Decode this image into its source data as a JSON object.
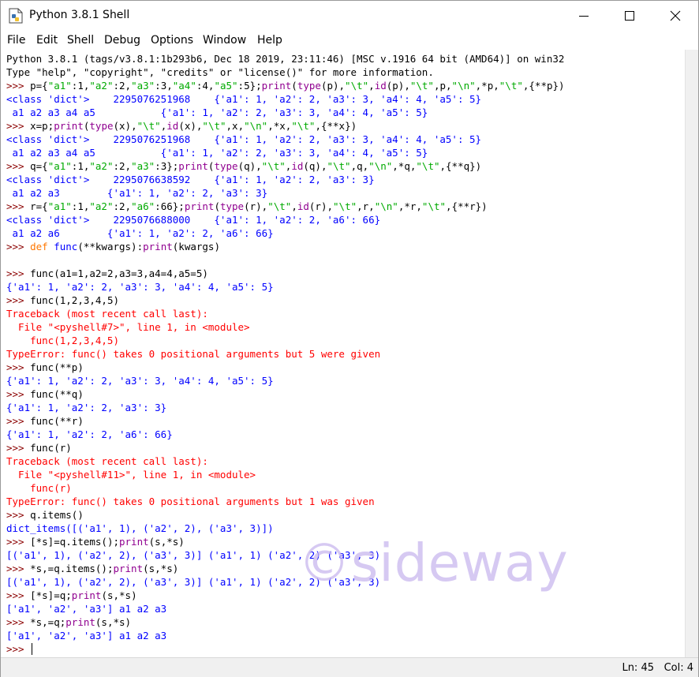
{
  "window": {
    "title": "Python 3.8.1 Shell"
  },
  "menu": [
    "File",
    "Edit",
    "Shell",
    "Debug",
    "Options",
    "Window",
    "Help"
  ],
  "shell": {
    "lines": [
      [
        [
          "",
          "Python 3.8.1 (tags/v3.8.1:1b293b6, Dec 18 2019, 23:11:46) [MSC v.1916 64 bit (AMD64)] on win32"
        ]
      ],
      [
        [
          "",
          "Type \"help\", \"copyright\", \"credits\" or \"license()\" for more information."
        ]
      ],
      [
        [
          "p",
          ">>> "
        ],
        [
          "",
          "p={"
        ],
        [
          "s",
          "\"a1\""
        ],
        [
          "",
          ":1,"
        ],
        [
          "s",
          "\"a2\""
        ],
        [
          "",
          ":2,"
        ],
        [
          "s",
          "\"a3\""
        ],
        [
          "",
          ":3,"
        ],
        [
          "s",
          "\"a4\""
        ],
        [
          "",
          ":4,"
        ],
        [
          "s",
          "\"a5\""
        ],
        [
          "",
          ":5};"
        ],
        [
          "b",
          "print"
        ],
        [
          "",
          "("
        ],
        [
          "b",
          "type"
        ],
        [
          "",
          "(p),"
        ],
        [
          "s",
          "\"\\t\""
        ],
        [
          "",
          ","
        ],
        [
          "b",
          "id"
        ],
        [
          "",
          "(p),"
        ],
        [
          "s",
          "\"\\t\""
        ],
        [
          "",
          ",p,"
        ],
        [
          "s",
          "\"\\n\""
        ],
        [
          "",
          ",*p,"
        ],
        [
          "s",
          "\"\\t\""
        ],
        [
          "",
          ",{**p})"
        ]
      ],
      [
        [
          "o",
          "<class 'dict'>    2295076251968    {'a1': 1, 'a2': 2, 'a3': 3, 'a4': 4, 'a5': 5}"
        ]
      ],
      [
        [
          "o",
          " a1 a2 a3 a4 a5           {'a1': 1, 'a2': 2, 'a3': 3, 'a4': 4, 'a5': 5}"
        ]
      ],
      [
        [
          "p",
          ">>> "
        ],
        [
          "",
          "x=p;"
        ],
        [
          "b",
          "print"
        ],
        [
          "",
          "("
        ],
        [
          "b",
          "type"
        ],
        [
          "",
          "(x),"
        ],
        [
          "s",
          "\"\\t\""
        ],
        [
          "",
          ","
        ],
        [
          "b",
          "id"
        ],
        [
          "",
          "(x),"
        ],
        [
          "s",
          "\"\\t\""
        ],
        [
          "",
          ",x,"
        ],
        [
          "s",
          "\"\\n\""
        ],
        [
          "",
          ",*x,"
        ],
        [
          "s",
          "\"\\t\""
        ],
        [
          "",
          ",{**x})"
        ]
      ],
      [
        [
          "o",
          "<class 'dict'>    2295076251968    {'a1': 1, 'a2': 2, 'a3': 3, 'a4': 4, 'a5': 5}"
        ]
      ],
      [
        [
          "o",
          " a1 a2 a3 a4 a5           {'a1': 1, 'a2': 2, 'a3': 3, 'a4': 4, 'a5': 5}"
        ]
      ],
      [
        [
          "p",
          ">>> "
        ],
        [
          "",
          "q={"
        ],
        [
          "s",
          "\"a1\""
        ],
        [
          "",
          ":1,"
        ],
        [
          "s",
          "\"a2\""
        ],
        [
          "",
          ":2,"
        ],
        [
          "s",
          "\"a3\""
        ],
        [
          "",
          ":3};"
        ],
        [
          "b",
          "print"
        ],
        [
          "",
          "("
        ],
        [
          "b",
          "type"
        ],
        [
          "",
          "(q),"
        ],
        [
          "s",
          "\"\\t\""
        ],
        [
          "",
          ","
        ],
        [
          "b",
          "id"
        ],
        [
          "",
          "(q),"
        ],
        [
          "s",
          "\"\\t\""
        ],
        [
          "",
          ",q,"
        ],
        [
          "s",
          "\"\\n\""
        ],
        [
          "",
          ",*q,"
        ],
        [
          "s",
          "\"\\t\""
        ],
        [
          "",
          ",{**q})"
        ]
      ],
      [
        [
          "o",
          "<class 'dict'>    2295076638592    {'a1': 1, 'a2': 2, 'a3': 3}"
        ]
      ],
      [
        [
          "o",
          " a1 a2 a3        {'a1': 1, 'a2': 2, 'a3': 3}"
        ]
      ],
      [
        [
          "p",
          ">>> "
        ],
        [
          "",
          "r={"
        ],
        [
          "s",
          "\"a1\""
        ],
        [
          "",
          ":1,"
        ],
        [
          "s",
          "\"a2\""
        ],
        [
          "",
          ":2,"
        ],
        [
          "s",
          "\"a6\""
        ],
        [
          "",
          ":66};"
        ],
        [
          "b",
          "print"
        ],
        [
          "",
          "("
        ],
        [
          "b",
          "type"
        ],
        [
          "",
          "(r),"
        ],
        [
          "s",
          "\"\\t\""
        ],
        [
          "",
          ","
        ],
        [
          "b",
          "id"
        ],
        [
          "",
          "(r),"
        ],
        [
          "s",
          "\"\\t\""
        ],
        [
          "",
          ",r,"
        ],
        [
          "s",
          "\"\\n\""
        ],
        [
          "",
          ",*r,"
        ],
        [
          "s",
          "\"\\t\""
        ],
        [
          "",
          ",{**r})"
        ]
      ],
      [
        [
          "o",
          "<class 'dict'>    2295076688000    {'a1': 1, 'a2': 2, 'a6': 66}"
        ]
      ],
      [
        [
          "o",
          " a1 a2 a6        {'a1': 1, 'a2': 2, 'a6': 66}"
        ]
      ],
      [
        [
          "p",
          ">>> "
        ],
        [
          "k",
          "def"
        ],
        [
          "",
          " "
        ],
        [
          "o",
          "func"
        ],
        [
          "",
          "(**kwargs):"
        ],
        [
          "b",
          "print"
        ],
        [
          "",
          "(kwargs)"
        ]
      ],
      [
        [
          "",
          ""
        ]
      ],
      [
        [
          "p",
          ">>> "
        ],
        [
          "",
          "func(a1=1,a2=2,a3=3,a4=4,a5=5)"
        ]
      ],
      [
        [
          "o",
          "{'a1': 1, 'a2': 2, 'a3': 3, 'a4': 4, 'a5': 5}"
        ]
      ],
      [
        [
          "p",
          ">>> "
        ],
        [
          "",
          "func(1,2,3,4,5)"
        ]
      ],
      [
        [
          "e",
          "Traceback (most recent call last):"
        ]
      ],
      [
        [
          "e",
          "  File \"<pyshell#7>\", line 1, in <module>"
        ]
      ],
      [
        [
          "e",
          "    func(1,2,3,4,5)"
        ]
      ],
      [
        [
          "e",
          "TypeError: func() takes 0 positional arguments but 5 were given"
        ]
      ],
      [
        [
          "p",
          ">>> "
        ],
        [
          "",
          "func(**p)"
        ]
      ],
      [
        [
          "o",
          "{'a1': 1, 'a2': 2, 'a3': 3, 'a4': 4, 'a5': 5}"
        ]
      ],
      [
        [
          "p",
          ">>> "
        ],
        [
          "",
          "func(**q)"
        ]
      ],
      [
        [
          "o",
          "{'a1': 1, 'a2': 2, 'a3': 3}"
        ]
      ],
      [
        [
          "p",
          ">>> "
        ],
        [
          "",
          "func(**r)"
        ]
      ],
      [
        [
          "o",
          "{'a1': 1, 'a2': 2, 'a6': 66}"
        ]
      ],
      [
        [
          "p",
          ">>> "
        ],
        [
          "",
          "func(r)"
        ]
      ],
      [
        [
          "e",
          "Traceback (most recent call last):"
        ]
      ],
      [
        [
          "e",
          "  File \"<pyshell#11>\", line 1, in <module>"
        ]
      ],
      [
        [
          "e",
          "    func(r)"
        ]
      ],
      [
        [
          "e",
          "TypeError: func() takes 0 positional arguments but 1 was given"
        ]
      ],
      [
        [
          "p",
          ">>> "
        ],
        [
          "",
          "q.items()"
        ]
      ],
      [
        [
          "o",
          "dict_items([('a1', 1), ('a2', 2), ('a3', 3)])"
        ]
      ],
      [
        [
          "p",
          ">>> "
        ],
        [
          "",
          "[*s]=q.items();"
        ],
        [
          "b",
          "print"
        ],
        [
          "",
          "(s,*s)"
        ]
      ],
      [
        [
          "o",
          "[('a1', 1), ('a2', 2), ('a3', 3)] ('a1', 1) ('a2', 2) ('a3', 3)"
        ]
      ],
      [
        [
          "p",
          ">>> "
        ],
        [
          "",
          "*s,=q.items();"
        ],
        [
          "b",
          "print"
        ],
        [
          "",
          "(s,*s)"
        ]
      ],
      [
        [
          "o",
          "[('a1', 1), ('a2', 2), ('a3', 3)] ('a1', 1) ('a2', 2) ('a3', 3)"
        ]
      ],
      [
        [
          "p",
          ">>> "
        ],
        [
          "",
          "[*s]=q;"
        ],
        [
          "b",
          "print"
        ],
        [
          "",
          "(s,*s)"
        ]
      ],
      [
        [
          "o",
          "['a1', 'a2', 'a3'] a1 a2 a3"
        ]
      ],
      [
        [
          "p",
          ">>> "
        ],
        [
          "",
          "*s,=q;"
        ],
        [
          "b",
          "print"
        ],
        [
          "",
          "(s,*s)"
        ]
      ],
      [
        [
          "o",
          "['a1', 'a2', 'a3'] a1 a2 a3"
        ]
      ],
      [
        [
          "p",
          ">>> "
        ]
      ]
    ],
    "watermark": "©sideway"
  },
  "status": {
    "line": "Ln: 45",
    "col": "Col: 4"
  },
  "colors": {
    "prompt": "#8b0000",
    "keyword": "#ff7700",
    "builtin": "#900090",
    "string": "#00aa00",
    "output": "#0000ff",
    "error": "#ff0000"
  },
  "icons": {
    "app": "python-file-icon",
    "minimize": "minimize-icon",
    "maximize": "maximize-icon",
    "close": "close-icon"
  }
}
